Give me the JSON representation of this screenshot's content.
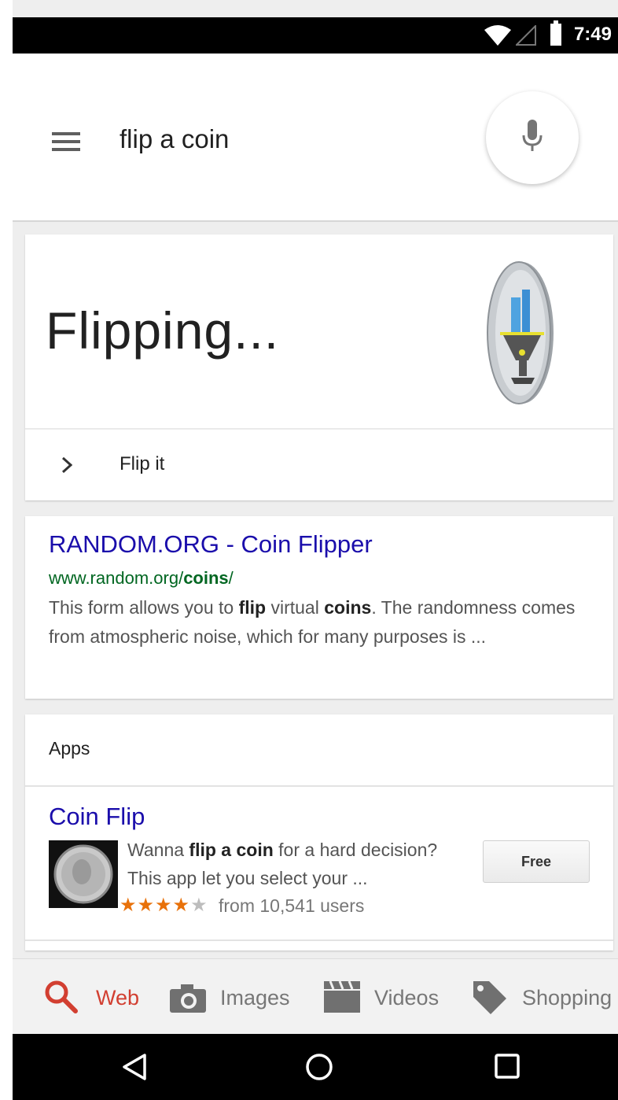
{
  "status_bar": {
    "time": "7:49",
    "icons": [
      "wifi-icon",
      "cell-signal-icon",
      "battery-icon"
    ]
  },
  "search": {
    "query": "flip a coin"
  },
  "coin_card": {
    "status": "Flipping...",
    "action_label": "Flip it"
  },
  "result": {
    "title": "RANDOM.ORG - Coin Flipper",
    "url_prefix": "www.random.org/",
    "url_bold": "coins",
    "url_suffix": "/",
    "snippet_1": "This form allows you to ",
    "snippet_b1": "flip",
    "snippet_2": " virtual ",
    "snippet_b2": "coins",
    "snippet_3": ". The randomness comes from atmospheric noise, which for many purposes is ..."
  },
  "apps": {
    "header": "Apps",
    "app_title": "Coin Flip",
    "desc_1": "Wanna ",
    "desc_b": "flip a coin",
    "desc_2": " for a hard decision? This app let you select your ...",
    "stars_on": "★★★★",
    "stars_off": "★",
    "rating_text": "from 10,541 users",
    "price_label": "Free",
    "rating_value": 4
  },
  "tabs": [
    {
      "label": "Web",
      "icon": "search-icon",
      "active": true
    },
    {
      "label": "Images",
      "icon": "camera-icon",
      "active": false
    },
    {
      "label": "Videos",
      "icon": "clapperboard-icon",
      "active": false
    },
    {
      "label": "Shopping",
      "icon": "tag-icon",
      "active": false
    }
  ],
  "colors": {
    "link": "#1a0dab",
    "url": "#006621",
    "active_tab": "#d23f31",
    "stars": "#e8710a"
  }
}
